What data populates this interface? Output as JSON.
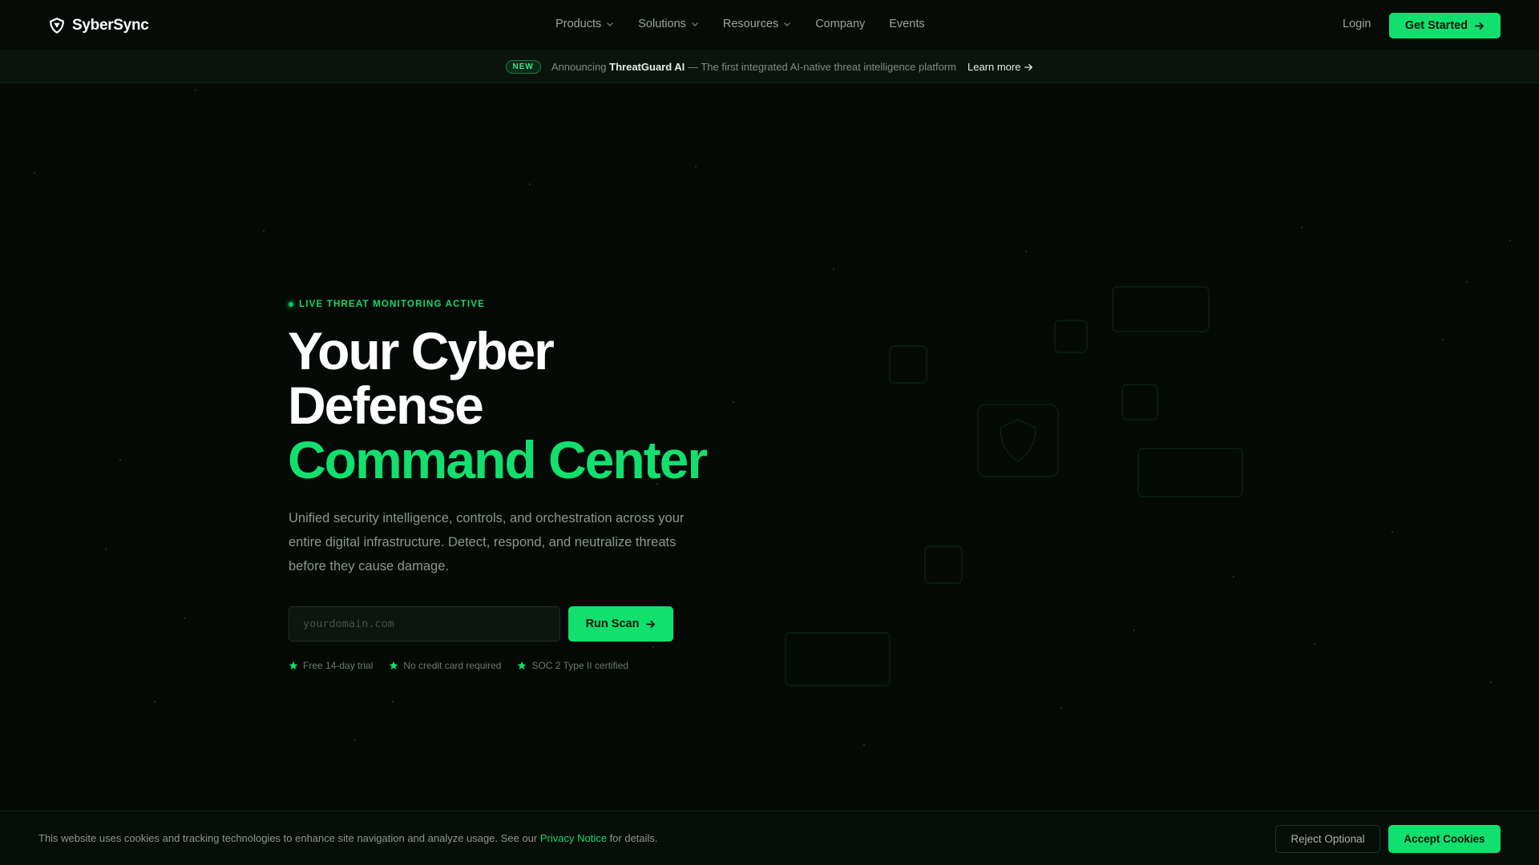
{
  "nav": {
    "brand": "SyberSync",
    "links": [
      {
        "label": "Products",
        "has_dropdown": true
      },
      {
        "label": "Solutions",
        "has_dropdown": true
      },
      {
        "label": "Resources",
        "has_dropdown": true
      },
      {
        "label": "Company",
        "has_dropdown": false
      },
      {
        "label": "Events",
        "has_dropdown": false
      }
    ],
    "login_label": "Login",
    "cta_label": "Get Started"
  },
  "announcement": {
    "badge": "NEW",
    "prefix": "Announcing",
    "product": "ThreatGuard AI",
    "suffix": "— The first integrated AI-native threat intelligence platform",
    "link_label": "Learn more"
  },
  "hero": {
    "status": "LIVE THREAT MONITORING ACTIVE",
    "headline_line1": "Your Cyber",
    "headline_line2": "Defense",
    "headline_accent": "Command Center",
    "description": "Unified security intelligence, controls, and orchestration across your entire digital infrastructure. Detect, respond, and neutralize threats before they cause damage.",
    "domain_placeholder": "yourdomain.com",
    "scan_label": "Run Scan",
    "perks": [
      "Free 14-day trial",
      "No credit card required",
      "SOC 2 Type II certified"
    ]
  },
  "cookie": {
    "text_before": "This website uses cookies and tracking technologies to enhance site navigation and analyze usage. See our",
    "link": "Privacy Notice",
    "text_after": "for details.",
    "reject_label": "Reject Optional",
    "accept_label": "Accept Cookies"
  },
  "colors": {
    "accent": "#12e06e",
    "background": "#050a06"
  },
  "icons": {
    "logo": "shield-logo-icon",
    "dropdown": "chevron-down-icon",
    "arrow": "arrow-right-icon",
    "perk": "star-icon"
  }
}
